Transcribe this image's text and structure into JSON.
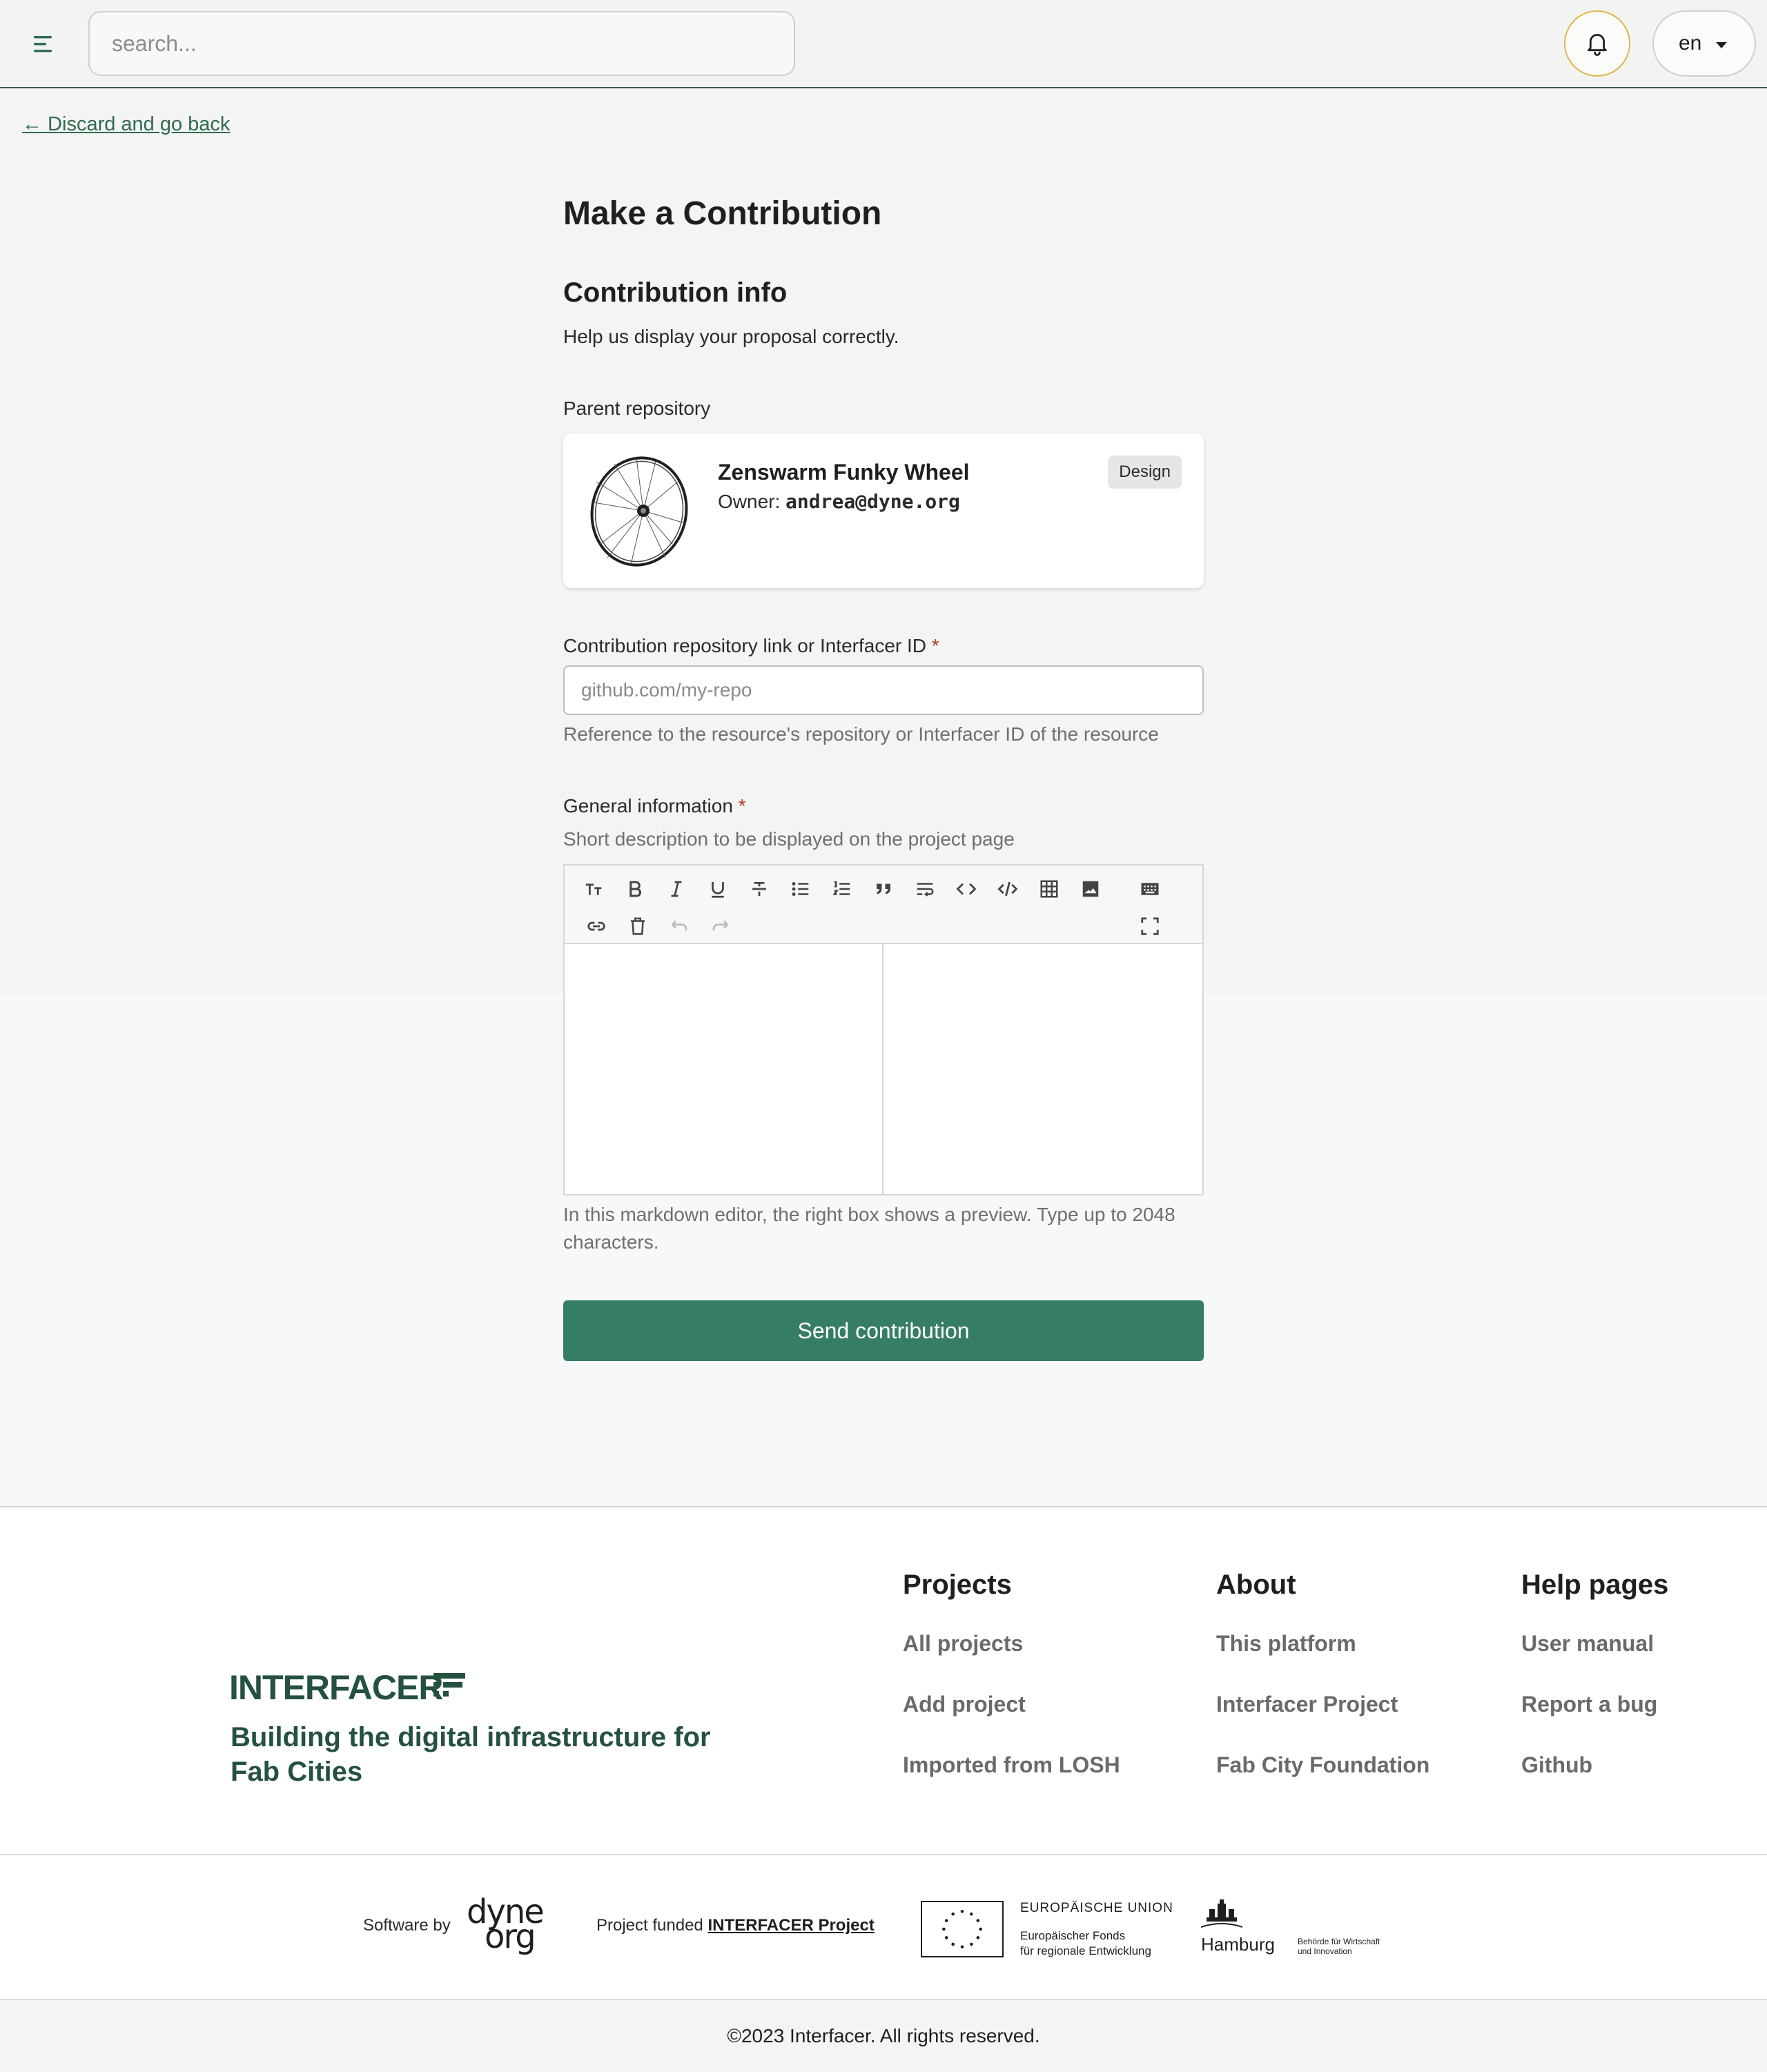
{
  "header": {
    "search_placeholder": "search...",
    "language": "en"
  },
  "nav": {
    "back_label": "← Discard and go back"
  },
  "form": {
    "title": "Make a Contribution",
    "section_title": "Contribution info",
    "section_subtitle": "Help us display your proposal correctly.",
    "parent_label": "Parent repository",
    "parent_repo": {
      "name": "Zenswarm Funky Wheel",
      "owner_prefix": "Owner:",
      "owner": "andrea@dyne.org",
      "badge": "Design"
    },
    "repo_link_label": "Contribution repository link or Interfacer ID",
    "required_mark": "*",
    "repo_link_placeholder": "github.com/my-repo",
    "repo_link_hint": "Reference to the resource's repository or Interfacer ID of the resource",
    "general_info_label": "General information",
    "general_info_hint": "Short description to be displayed on the project page",
    "editor_hint": "In this markdown editor, the right box shows a preview. Type up to 2048 characters.",
    "submit_label": "Send contribution"
  },
  "footer": {
    "logo_text": "INTERFACER",
    "tagline": "Building the digital infrastructure for Fab Cities",
    "columns": [
      {
        "title": "Projects",
        "links": [
          "All projects",
          "Add project",
          "Imported from LOSH"
        ]
      },
      {
        "title": "About",
        "links": [
          "This platform",
          "Interfacer Project",
          "Fab City Foundation"
        ]
      },
      {
        "title": "Help pages",
        "links": [
          "User manual",
          "Report a bug",
          "Github"
        ]
      }
    ],
    "software_by": "Software by",
    "dyne_line1": "dyne",
    "dyne_line2": "org",
    "funded_prefix": "Project funded",
    "funded_link": "INTERFACER Project",
    "eu_title": "EUROPÄISCHE UNION",
    "eu_sub_1": "Europäischer Fonds",
    "eu_sub_2": "für regionale Entwicklung",
    "hamburg": "Hamburg",
    "hamburg_sub_1": "Behörde für Wirtschaft",
    "hamburg_sub_2": "und Innovation",
    "copyright": "©2023 Interfacer. All rights reserved."
  },
  "colors": {
    "brand_green": "#367e63",
    "dark_green": "#25513f",
    "bell_ring": "#e0b64a",
    "required": "#c0392b"
  },
  "icons": [
    "menu-icon",
    "bell-icon",
    "chevron-down-icon",
    "heading-icon",
    "bold-icon",
    "italic-icon",
    "underline-icon",
    "strikethrough-icon",
    "bullet-list-icon",
    "ordered-list-icon",
    "quote-icon",
    "wrap-icon",
    "code-icon",
    "code-block-icon",
    "table-icon",
    "image-icon",
    "keyboard-icon",
    "link-icon",
    "trash-icon",
    "undo-icon",
    "redo-icon",
    "fullscreen-icon"
  ]
}
